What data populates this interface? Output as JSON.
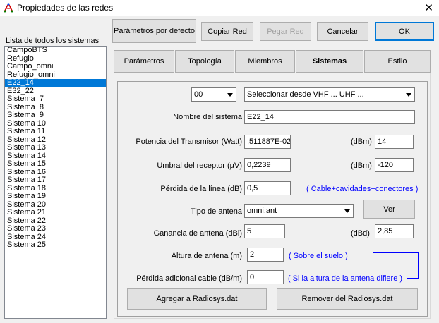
{
  "window": {
    "title": "Propiedades de las redes",
    "close_glyph": "✕"
  },
  "toolbar": {
    "defaults_label": "Parámetros por defecto",
    "copy_label": "Copiar Red",
    "paste_label": "Pegar Red",
    "cancel_label": "Cancelar",
    "ok_label": "OK"
  },
  "sidebar": {
    "label": "Lista de todos los sistemas",
    "selected_index": 4,
    "items": [
      "CampoBTS",
      "Refugio",
      "Campo_omni",
      "Refugio_omni",
      "E22_14",
      "E32_22",
      "Sistema  7",
      "Sistema  8",
      "Sistema  9",
      "Sistema 10",
      "Sistema 11",
      "Sistema 12",
      "Sistema 13",
      "Sistema 14",
      "Sistema 15",
      "Sistema 16",
      "Sistema 17",
      "Sistema 18",
      "Sistema 19",
      "Sistema 20",
      "Sistema 21",
      "Sistema 22",
      "Sistema 23",
      "Sistema 24",
      "Sistema 25"
    ]
  },
  "tabs": [
    {
      "label": "Parámetros",
      "active": false
    },
    {
      "label": "Topología",
      "active": false
    },
    {
      "label": "Miembros",
      "active": false
    },
    {
      "label": "Sistemas",
      "active": true
    },
    {
      "label": "Estilo",
      "active": false
    }
  ],
  "system": {
    "index_value": "00",
    "preset_value": "Seleccionar desde VHF ... UHF ...",
    "name_label": "Nombre del sistema",
    "name_value": "E22_14",
    "tx_power_label": "Potencia del Transmisor (Watt)",
    "tx_power_value": ",511887E-02",
    "tx_dbm_label": "(dBm)",
    "tx_dbm_value": "14",
    "rx_threshold_label": "Umbral del receptor (µV)",
    "rx_threshold_value": "0,2239",
    "rx_dbm_label": "(dBm)",
    "rx_dbm_value": "-120",
    "line_loss_label": "Pérdida de la línea (dB)",
    "line_loss_value": "0,5",
    "line_loss_note": "( Cable+cavidades+conectores )",
    "antenna_type_label": "Tipo de antena",
    "antenna_type_value": "omni.ant",
    "view_label": "Ver",
    "gain_label": "Ganancia de antena (dBi)",
    "gain_dbi_value": "5",
    "gain_dbd_label": "(dBd)",
    "gain_dbd_value": "2,85",
    "height_label": "Altura de antena (m)",
    "height_value": "2",
    "height_note": "( Sobre el suelo )",
    "cable_loss_label": "Pérdida adicional cable (dB/m)",
    "cable_loss_value": "0",
    "cable_loss_note": "( Si la altura de la antena difiere )",
    "add_label": "Agregar a Radiosys.dat",
    "remove_label": "Remover del Radiosys.dat"
  }
}
